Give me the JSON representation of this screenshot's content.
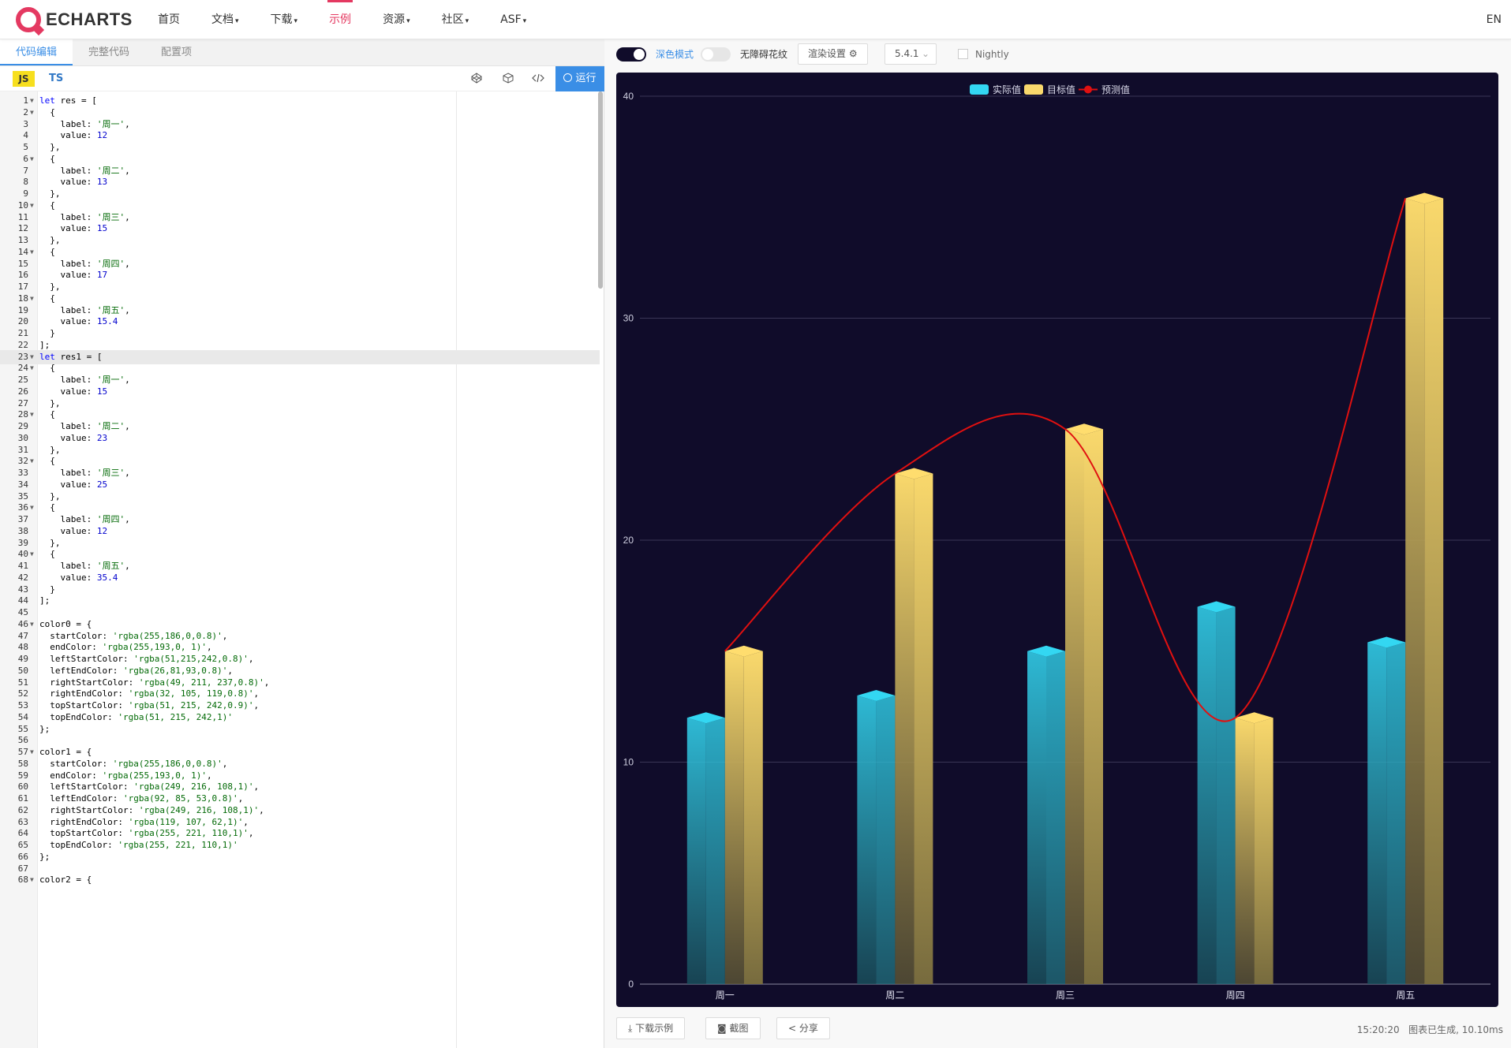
{
  "nav": {
    "logo_text": "ECHARTS",
    "items": [
      {
        "label": "首页",
        "caret": ""
      },
      {
        "label": "文档",
        "caret": "▾"
      },
      {
        "label": "下载",
        "caret": "▾"
      },
      {
        "label": "示例",
        "caret": ""
      },
      {
        "label": "资源",
        "caret": "▾"
      },
      {
        "label": "社区",
        "caret": "▾"
      },
      {
        "label": "ASF",
        "caret": "▾"
      }
    ],
    "active_index": 3,
    "lang": "EN"
  },
  "editor": {
    "tabs": [
      "代码编辑",
      "完整代码",
      "配置项"
    ],
    "lang_js": "JS",
    "lang_ts": "TS",
    "run_label": "运行",
    "active_line": 23,
    "lines": [
      "let res = [",
      "  {",
      "    label: '周一',",
      "    value: 12",
      "  },",
      "  {",
      "    label: '周二',",
      "    value: 13",
      "  },",
      "  {",
      "    label: '周三',",
      "    value: 15",
      "  },",
      "  {",
      "    label: '周四',",
      "    value: 17",
      "  },",
      "  {",
      "    label: '周五',",
      "    value: 15.4",
      "  }",
      "];",
      "let res1 = [",
      "  {",
      "    label: '周一',",
      "    value: 15",
      "  },",
      "  {",
      "    label: '周二',",
      "    value: 23",
      "  },",
      "  {",
      "    label: '周三',",
      "    value: 25",
      "  },",
      "  {",
      "    label: '周四',",
      "    value: 12",
      "  },",
      "  {",
      "    label: '周五',",
      "    value: 35.4",
      "  }",
      "];",
      "",
      "color0 = {",
      "  startColor: 'rgba(255,186,0,0.8)',",
      "  endColor: 'rgba(255,193,0, 1)',",
      "  leftStartColor: 'rgba(51,215,242,0.8)',",
      "  leftEndColor: 'rgba(26,81,93,0.8)',",
      "  rightStartColor: 'rgba(49, 211, 237,0.8)',",
      "  rightEndColor: 'rgba(32, 105, 119,0.8)',",
      "  topStartColor: 'rgba(51, 215, 242,0.9)',",
      "  topEndColor: 'rgba(51, 215, 242,1)'",
      "};",
      "",
      "color1 = {",
      "  startColor: 'rgba(255,186,0,0.8)',",
      "  endColor: 'rgba(255,193,0, 1)',",
      "  leftStartColor: 'rgba(249, 216, 108,1)',",
      "  leftEndColor: 'rgba(92, 85, 53,0.8)',",
      "  rightStartColor: 'rgba(249, 216, 108,1)',",
      "  rightEndColor: 'rgba(119, 107, 62,1)',",
      "  topStartColor: 'rgba(255, 221, 110,1)',",
      "  topEndColor: 'rgba(255, 221, 110,1)'",
      "};",
      "",
      "color2 = {"
    ],
    "fold_lines": [
      1,
      2,
      6,
      10,
      14,
      18,
      23,
      24,
      28,
      32,
      36,
      40,
      46,
      57,
      68
    ]
  },
  "toolbar": {
    "dark_mode_label": "深色模式",
    "dark_mode_on": true,
    "aria_label": "无障碍花纹",
    "aria_on": false,
    "render_label": "渲染设置",
    "version": "5.4.1",
    "nightly_label": "Nightly"
  },
  "chart_data": {
    "type": "bar",
    "categories": [
      "周一",
      "周二",
      "周三",
      "周四",
      "周五"
    ],
    "series": [
      {
        "name": "实际值",
        "type": "bar",
        "values": [
          12,
          13,
          15,
          17,
          15.4
        ],
        "color": "#33d7f2"
      },
      {
        "name": "目标值",
        "type": "bar",
        "values": [
          15,
          23,
          25,
          12,
          35.4
        ],
        "color": "#f9d86c"
      },
      {
        "name": "预测值",
        "type": "line",
        "smooth": true,
        "values": [
          15,
          23,
          25,
          12,
          35.4
        ],
        "color": "#e01010"
      }
    ],
    "ylim": [
      0,
      40
    ],
    "yticks": [
      0,
      10,
      20,
      30,
      40
    ],
    "legend_position": "top-center",
    "grid": true,
    "background": "#100c2a"
  },
  "bottom": {
    "download_label": "下载示例",
    "screenshot_label": "截图",
    "share_label": "分享",
    "time": "15:20:20",
    "status": "图表已生成, 10.10ms"
  }
}
